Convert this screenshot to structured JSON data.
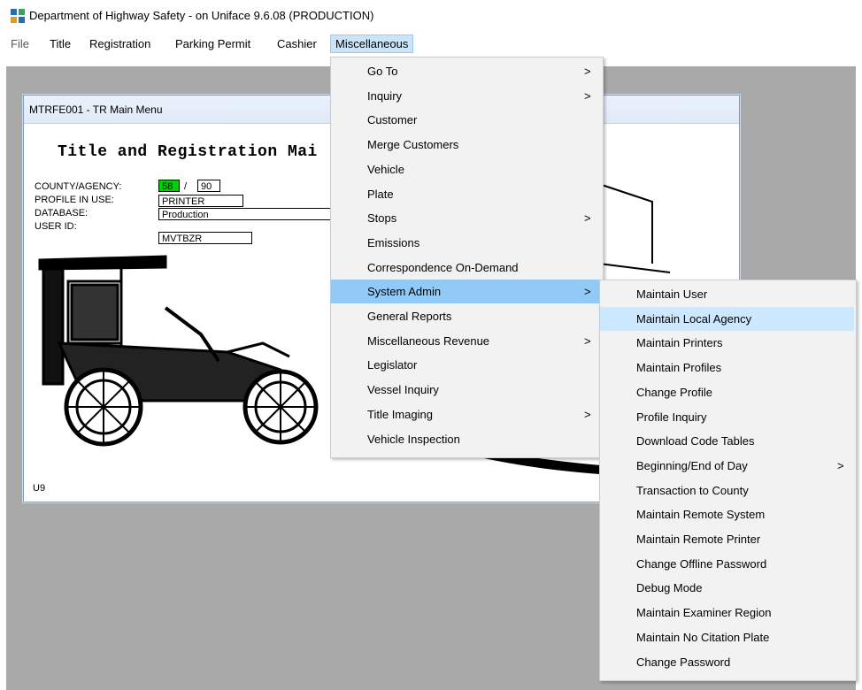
{
  "window": {
    "title": "Department of Highway Safety - on Uniface 9.6.08 (PRODUCTION)"
  },
  "menubar": [
    "File",
    "Title",
    "Registration",
    "Parking Permit",
    "Cashier",
    "Miscellaneous"
  ],
  "inner_window": {
    "title": "MTRFE001 - TR Main Menu",
    "heading": "Title and Registration Mai",
    "fields": {
      "county_label": "COUNTY/AGENCY:",
      "county_value": "58",
      "slash": "/",
      "agency_value": "90",
      "profile_label": "PROFILE IN USE:",
      "profile_value": "PRINTER",
      "database_label": "DATABASE:",
      "database_value": "Production",
      "userid_label": "USER ID:",
      "userid_value": "MVTBZR"
    },
    "footer": "U9"
  },
  "misc_menu": [
    {
      "label": "Go To",
      "submenu": true
    },
    {
      "label": "Inquiry",
      "submenu": true
    },
    {
      "label": "Customer",
      "submenu": false
    },
    {
      "label": "Merge Customers",
      "submenu": false
    },
    {
      "label": "Vehicle",
      "submenu": false
    },
    {
      "label": "Plate",
      "submenu": false
    },
    {
      "label": "Stops",
      "submenu": true
    },
    {
      "label": "Emissions",
      "submenu": false
    },
    {
      "label": "Correspondence On-Demand",
      "submenu": false
    },
    {
      "label": "System Admin",
      "submenu": true
    },
    {
      "label": "General Reports",
      "submenu": false
    },
    {
      "label": "Miscellaneous Revenue",
      "submenu": true
    },
    {
      "label": "Legislator",
      "submenu": false
    },
    {
      "label": "Vessel Inquiry",
      "submenu": false
    },
    {
      "label": "Title Imaging",
      "submenu": true
    },
    {
      "label": "Vehicle Inspection",
      "submenu": false
    }
  ],
  "sysadmin_menu": [
    {
      "label": "Maintain User",
      "submenu": false
    },
    {
      "label": "Maintain Local Agency",
      "submenu": false
    },
    {
      "label": "Maintain Printers",
      "submenu": false
    },
    {
      "label": "Maintain Profiles",
      "submenu": false
    },
    {
      "label": "Change Profile",
      "submenu": false
    },
    {
      "label": "Profile Inquiry",
      "submenu": false
    },
    {
      "label": "Download Code Tables",
      "submenu": false
    },
    {
      "label": "Beginning/End of Day",
      "submenu": true
    },
    {
      "label": "Transaction to County",
      "submenu": false
    },
    {
      "label": "Maintain Remote System",
      "submenu": false
    },
    {
      "label": "Maintain Remote Printer",
      "submenu": false
    },
    {
      "label": "Change Offline Password",
      "submenu": false
    },
    {
      "label": "Debug Mode",
      "submenu": false
    },
    {
      "label": "Maintain Examiner Region",
      "submenu": false
    },
    {
      "label": "Maintain No Citation Plate",
      "submenu": false
    },
    {
      "label": "Change Password",
      "submenu": false
    }
  ],
  "submenu_arrow": ">",
  "colors": {
    "highlight": "#91c9f7",
    "hover": "#cce8ff",
    "menu_bg": "#f2f2f2",
    "workspace": "#a9a9a9",
    "county_field": "#00d100"
  },
  "icons": {
    "app": "app-logo-icon",
    "arrow": "chevron-right-icon",
    "image": "antique-car-image"
  }
}
